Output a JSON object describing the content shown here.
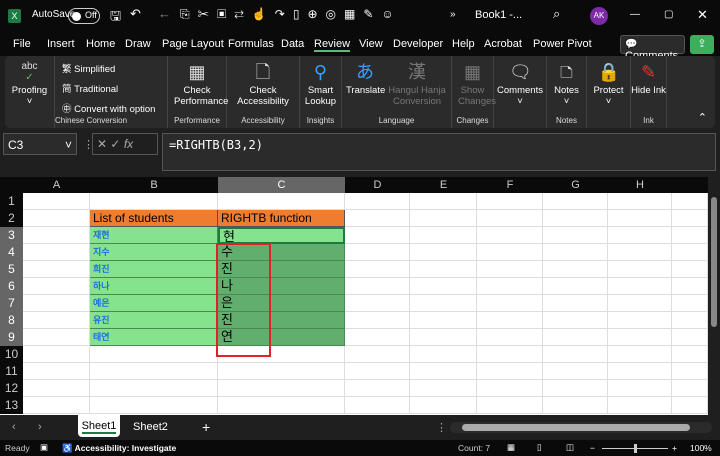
{
  "titlebar": {
    "autosave": "AutoSave",
    "toggle": "Off",
    "title": "Book1 -...",
    "avatar": "AK",
    "more": "»"
  },
  "menu": [
    "File",
    "Insert",
    "Home",
    "Draw",
    "Page Layout",
    "Formulas",
    "Data",
    "Review",
    "View",
    "Developer",
    "Help",
    "Acrobat",
    "Power Pivot"
  ],
  "comments_button": "Comments",
  "ribbon": {
    "proofing": {
      "label": "Proofing",
      "icon_text": "abc"
    },
    "chinese": {
      "items": [
        "Simplified",
        "Traditional",
        "Convert with option"
      ],
      "group": "Chinese Conversion"
    },
    "performance": {
      "label": "Check Performance",
      "group": "Performance"
    },
    "accessibility": {
      "label": "Check Accessibility",
      "group": "Accessibility"
    },
    "insights": {
      "label": "Smart Lookup",
      "group": "Insights"
    },
    "language": {
      "translate": "Translate",
      "hanja": "Hangul Hanja Conversion",
      "group": "Language"
    },
    "changes": {
      "label": "Show Changes",
      "group": "Changes"
    },
    "comments": {
      "label": "Comments"
    },
    "notes": {
      "label": "Notes",
      "group": "Notes"
    },
    "protect": {
      "label": "Protect"
    },
    "ink": {
      "label": "Hide Ink",
      "group": "Ink"
    }
  },
  "namebox": "C3",
  "formula": "=RIGHTB(B3,2)",
  "columns": [
    "A",
    "B",
    "C",
    "D",
    "E",
    "F",
    "G",
    "H"
  ],
  "rows": [
    "1",
    "2",
    "3",
    "4",
    "5",
    "6",
    "7",
    "8",
    "9",
    "10",
    "11",
    "12",
    "13"
  ],
  "headers": {
    "b": "List of students",
    "c": "RIGHTB function"
  },
  "names": [
    "재현",
    "지수",
    "희진",
    "하나",
    "예은",
    "유진",
    "태연"
  ],
  "results": [
    "현",
    "수",
    "진",
    "나",
    "은",
    "진",
    "연"
  ],
  "sheets": [
    "Sheet1",
    "Sheet2"
  ],
  "status": {
    "ready": "Ready",
    "accessibility": "Accessibility: Investigate",
    "count": "Count: 7",
    "zoom": "100%"
  },
  "colors": {
    "header": "#ed7d31",
    "names": "#86e38d",
    "results": "#62ae6e",
    "highlight": "#e0202a"
  }
}
